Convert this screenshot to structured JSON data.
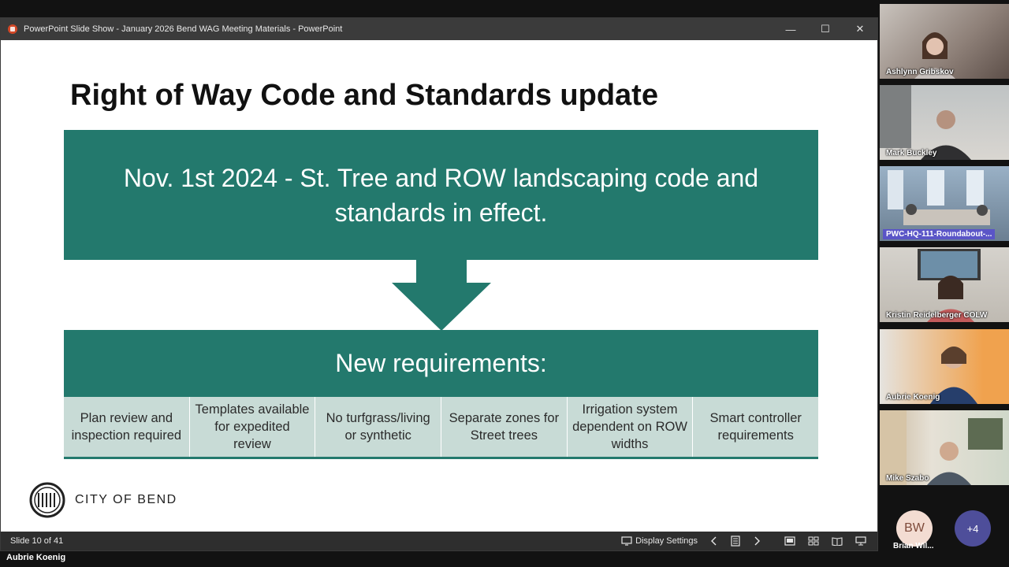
{
  "window": {
    "title": "PowerPoint Slide Show  -  January 2026 Bend WAG Meeting Materials - PowerPoint",
    "minimize": "—",
    "maximize": "☐",
    "close": "✕"
  },
  "slide": {
    "title": "Right of Way Code and Standards update",
    "banner": "Nov. 1st 2024 - St. Tree and ROW landscaping code and standards in effect.",
    "subhead": "New requirements:",
    "requirements": [
      "Plan review and inspection required",
      "Templates available for expedited review",
      "No turfgrass/living or synthetic",
      "Separate zones for Street trees",
      "Irrigation system dependent on ROW widths",
      "Smart controller requirements"
    ],
    "logo_text": "CITY OF BEND",
    "accent_color": "#23796d"
  },
  "statusbar": {
    "slide_count": "Slide 10 of 41",
    "display_settings": "Display Settings"
  },
  "participants": [
    {
      "name": "Ashlynn Gribskov"
    },
    {
      "name": "Mark Buckley"
    },
    {
      "name": "PWC-HQ-111-Roundabout-..."
    },
    {
      "name": "Kristin Reidelberger COLW"
    },
    {
      "name": "Aubrie Koenig"
    },
    {
      "name": "Mike Szabo"
    }
  ],
  "overflow": {
    "avatar_initials": "BW",
    "avatar_name": "Brian Wil...",
    "more_count": "+4"
  },
  "presenter": "Aubrie Koenig"
}
